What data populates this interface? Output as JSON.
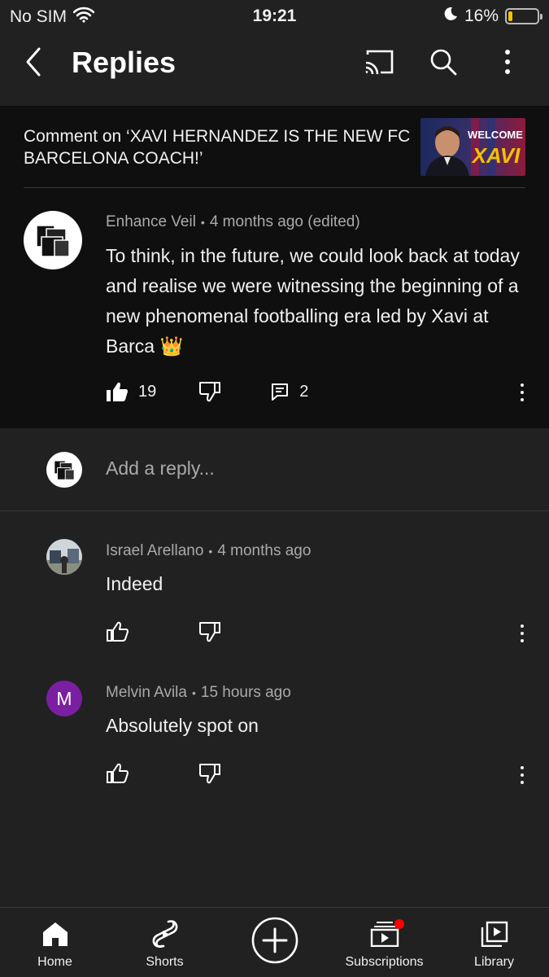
{
  "status_bar": {
    "carrier": "No SIM",
    "time": "19:21",
    "battery_percent": "16%",
    "battery_level": 0.16
  },
  "header": {
    "title": "Replies"
  },
  "context": {
    "text": "Comment on ‘XAVI HERNANDEZ IS THE NEW FC BARCELONA COACH!’",
    "thumbnail_text_line1": "WELCOME",
    "thumbnail_text_line2": "XAVI"
  },
  "main_comment": {
    "author": "Enhance Veil",
    "time": "4 months ago (edited)",
    "body": "To think, in the future, we could look back at today and realise we were witnessing the beginning of a new phenomenal footballing era led by Xavi at Barca 👑",
    "likes": "19",
    "replies_count": "2"
  },
  "reply_input": {
    "placeholder": "Add a reply..."
  },
  "replies": [
    {
      "author": "Israel Arellano",
      "time": "4 months ago",
      "body": "Indeed"
    },
    {
      "author": "Melvin Avila",
      "time": "15 hours ago",
      "body": "Absolutely spot on",
      "avatar_letter": "M",
      "avatar_color": "#7b1fa2"
    }
  ],
  "nav": {
    "items": [
      {
        "label": "Home",
        "icon": "home-icon"
      },
      {
        "label": "Shorts",
        "icon": "shorts-icon"
      },
      {
        "label": "",
        "icon": "create-icon"
      },
      {
        "label": "Subscriptions",
        "icon": "subscriptions-icon"
      },
      {
        "label": "Library",
        "icon": "library-icon"
      }
    ]
  },
  "colors": {
    "background": "#212121",
    "card": "#0f0f0f",
    "accent_red": "#ff0000",
    "battery_yellow": "#f5c400"
  }
}
